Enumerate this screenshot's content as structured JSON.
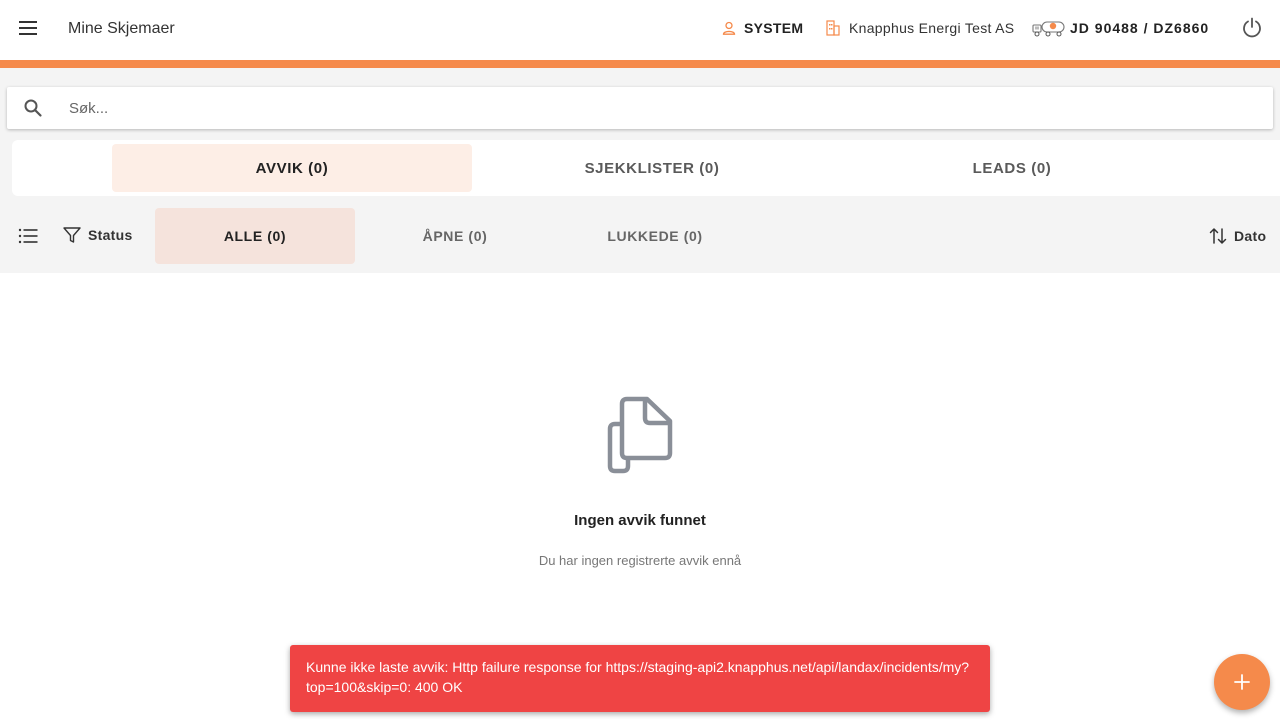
{
  "header": {
    "title": "Mine Skjemaer",
    "user": "SYSTEM",
    "company": "Knapphus Energi Test AS",
    "vehicle": "JD 90488 / DZ6860",
    "icons": {
      "menu": "hamburger-menu-icon",
      "user": "person-icon",
      "company": "building-icon",
      "vehicle": "tanker-truck-icon",
      "power": "power-icon"
    },
    "accent_color": "#f58a4b"
  },
  "search": {
    "placeholder": "Søk...",
    "value": ""
  },
  "tabs": [
    {
      "label": "AVVIK (0)",
      "active": true
    },
    {
      "label": "SJEKKLISTER (0)",
      "active": false
    },
    {
      "label": "LEADS (0)",
      "active": false
    }
  ],
  "filters": {
    "status_label": "Status",
    "subtabs": [
      {
        "label": "ALLE (0)",
        "active": true
      },
      {
        "label": "ÅPNE (0)",
        "active": false
      },
      {
        "label": "LUKKEDE (0)",
        "active": false
      }
    ],
    "sort_label": "Dato"
  },
  "empty_state": {
    "title": "Ingen avvik funnet",
    "subtitle": "Du har ingen registrerte avvik ennå",
    "icon": "documents-icon"
  },
  "snackbar": {
    "message": "Kunne ikke laste avvik: Http failure response for https://staging-api2.knapphus.net/api/landax/incidents/my?top=100&skip=0: 400 OK",
    "color": "#ef4444"
  },
  "fab": {
    "icon": "plus-icon"
  }
}
